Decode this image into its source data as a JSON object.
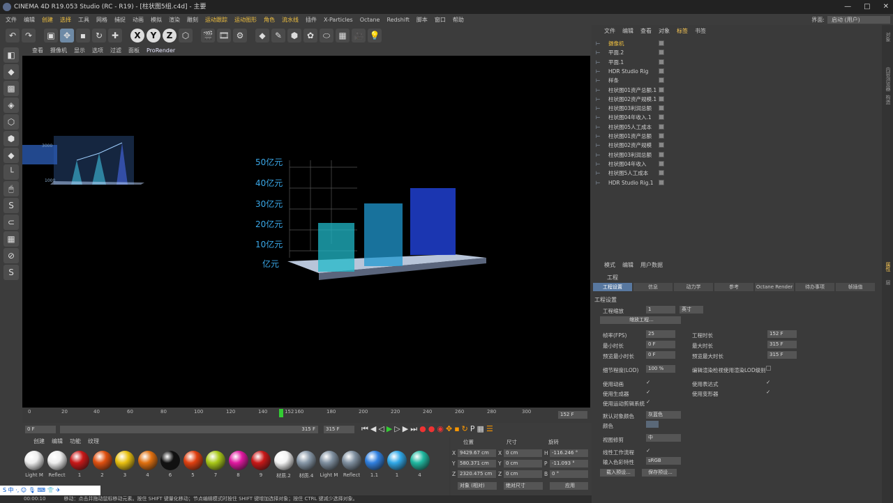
{
  "title": "CINEMA 4D R19.053 Studio (RC - R19) - [柱状图5组.c4d] - 主要",
  "menu": [
    "文件",
    "编辑",
    "创建",
    "选择",
    "工具",
    "网格",
    "捕捉",
    "动画",
    "模拟",
    "渲染",
    "雕刻",
    "运动跟踪",
    "运动图形",
    "角色",
    "流水线",
    "插件",
    "X-Particles",
    "Octane",
    "Redshift",
    "脚本",
    "窗口",
    "帮助"
  ],
  "layout_label": "界面:",
  "layout_value": "启动 (用户)",
  "viewport_menu": [
    "查看",
    "摄像机",
    "显示",
    "选项",
    "过滤",
    "面板",
    "ProRender"
  ],
  "chart_labels": [
    "50亿元",
    "40亿元",
    "30亿元",
    "20亿元",
    "10亿元",
    "亿元"
  ],
  "mini_labels": [
    "3000",
    "1000"
  ],
  "timeline_ticks": [
    "0",
    "20",
    "40",
    "60",
    "80",
    "100",
    "120",
    "140",
    "152",
    "160",
    "180",
    "200",
    "220",
    "240",
    "260",
    "280",
    "300"
  ],
  "frame_end": "152 F",
  "frame_start_field": "0 F",
  "frame_end_field": "315 F",
  "range_end_field": "315 F",
  "mat_menu": [
    "创建",
    "编辑",
    "功能",
    "纹理"
  ],
  "materials": [
    {
      "name": "Light M",
      "color": "#eeeeee"
    },
    {
      "name": "Reflect",
      "color": "#eeeeee"
    },
    {
      "name": "1",
      "color": "#c81818"
    },
    {
      "name": "2",
      "color": "#e05010"
    },
    {
      "name": "3",
      "color": "#e8c010"
    },
    {
      "name": "4",
      "color": "#e07010"
    },
    {
      "name": "6",
      "color": "#111111"
    },
    {
      "name": "5",
      "color": "#e04010"
    },
    {
      "name": "7",
      "color": "#a8c818"
    },
    {
      "name": "8",
      "color": "#e018a0"
    },
    {
      "name": "9",
      "color": "#c81818"
    },
    {
      "name": "材质.2",
      "color": "#f4f4f4"
    },
    {
      "name": "材质.4",
      "color": "#8898a8"
    },
    {
      "name": "Light M",
      "color": "#8090a0"
    },
    {
      "name": "Reflect",
      "color": "#8090a0"
    },
    {
      "name": "1.1",
      "color": "#3080e0"
    },
    {
      "name": "1",
      "color": "#30a8e8"
    },
    {
      "name": "4",
      "color": "#20b8a0"
    }
  ],
  "coords": {
    "pos": "位置",
    "size": "尺寸",
    "rot": "旋转",
    "x": "9429.67 cm",
    "y": "580.371 cm",
    "z": "2320.475 cm",
    "sx": "0 cm",
    "sy": "0 cm",
    "sz": "0 cm",
    "h": "-116.246 °",
    "p": "-11.093 °",
    "b": "0 °",
    "mode": "对象 (相对)",
    "sizemode": "绝对尺寸",
    "apply": "应用"
  },
  "status": "移动：点击并拖动鼠标移动元素。按住 SHIFT 键量化移动；节点编辑模式时按住 SHIFT 键增加选择对象；按住 CTRL 键减少选择对象。",
  "time": "00:00:10",
  "obj_menu": [
    "文件",
    "编辑",
    "查看",
    "对象",
    "标签",
    "书签"
  ],
  "objects": [
    "摄像机",
    "平面.2",
    "平面.1",
    "HDR Studio Rig",
    "样条",
    "柱状图01资产总额.1",
    "柱状图02资产规模.1",
    "柱状图03利润总额",
    "柱状图04年收入.1",
    "柱状图05人工成本",
    "柱状图01资产总额",
    "柱状图02资产规模",
    "柱状图03利润总额",
    "柱状图04年收入",
    "柱状图5人工成本",
    "HDR Studio Rig.1"
  ],
  "attr_menu": [
    "模式",
    "编辑",
    "用户数据"
  ],
  "attr_title": "工程",
  "attr_tabs": [
    "工程设置",
    "信息",
    "动力学",
    "参考",
    "Octane Render",
    "待办事项",
    "帧插值"
  ],
  "section": "工程设置",
  "settings": {
    "scale_l": "工程缩放",
    "scale_v": "1",
    "scale_u": "英寸",
    "scale_btn": "缩放工程...",
    "fps_l": "帧率(FPS)",
    "fps_v": "25",
    "dur_l": "工程时长",
    "dur_v": "152 F",
    "min_l": "最小时长",
    "min_v": "0 F",
    "max_l": "最大时长",
    "max_v": "315 F",
    "pmin_l": "预览最小时长",
    "pmin_v": "0 F",
    "pmax_l": "预览最大时长",
    "pmax_v": "315 F",
    "lod_l": "细节程度(LOD)",
    "lod_v": "100 %",
    "lod2_l": "编辑渲染检视使用渲染LOD级别",
    "anim_l": "使用动画",
    "expr_l": "使用表达式",
    "gen_l": "使用生成器",
    "def_l": "使用变形器",
    "mo_l": "使用运动剪辑系统",
    "objcol_l": "默认对象颜色",
    "objcol_v": "灰蓝色",
    "col_l": "颜色",
    "clip_l": "视图修剪",
    "clip_v": "中",
    "lin_l": "线性工作流程",
    "incol_l": "输入色彩特性",
    "incol_v": "sRGB",
    "load_btn": "载入预设...",
    "save_btn": "保存预设..."
  }
}
